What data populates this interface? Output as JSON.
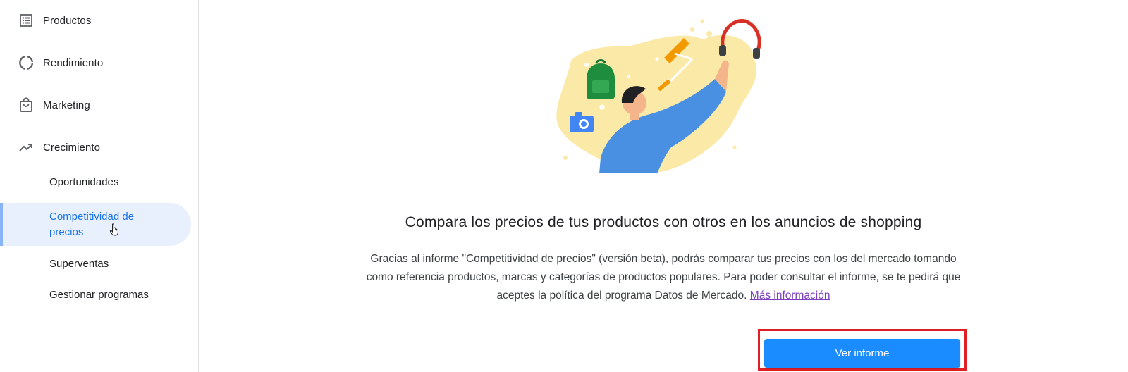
{
  "sidebar": {
    "items": [
      {
        "label": "Productos",
        "icon": "list-icon"
      },
      {
        "label": "Rendimiento",
        "icon": "donut-chart-icon"
      },
      {
        "label": "Marketing",
        "icon": "shopping-bag-icon"
      },
      {
        "label": "Crecimiento",
        "icon": "trending-up-icon"
      }
    ],
    "sub_items": [
      {
        "label": "Oportunidades"
      },
      {
        "label": "Competitividad de precios"
      },
      {
        "label": "Superventas"
      },
      {
        "label": "Gestionar programas"
      }
    ],
    "active_sub_item": "Competitividad de precios"
  },
  "main": {
    "headline": "Compara los precios de tus productos con otros en los anuncios de shopping",
    "body": "Gracias al informe \"Competitividad de precios\" (versión beta), podrás comparar tus precios con los del mercado tomando como referencia productos, marcas y categorías de productos populares. Para poder consultar el informe, se te pedirá que aceptes la política del programa Datos de Mercado.",
    "link_label": "Más información",
    "button_label": "Ver informe"
  },
  "colors": {
    "accent": "#1a73e8",
    "button": "#1a8cff",
    "active_bg": "#e8f0fe",
    "link": "#7b3fbf",
    "highlight": "#e01e26"
  }
}
